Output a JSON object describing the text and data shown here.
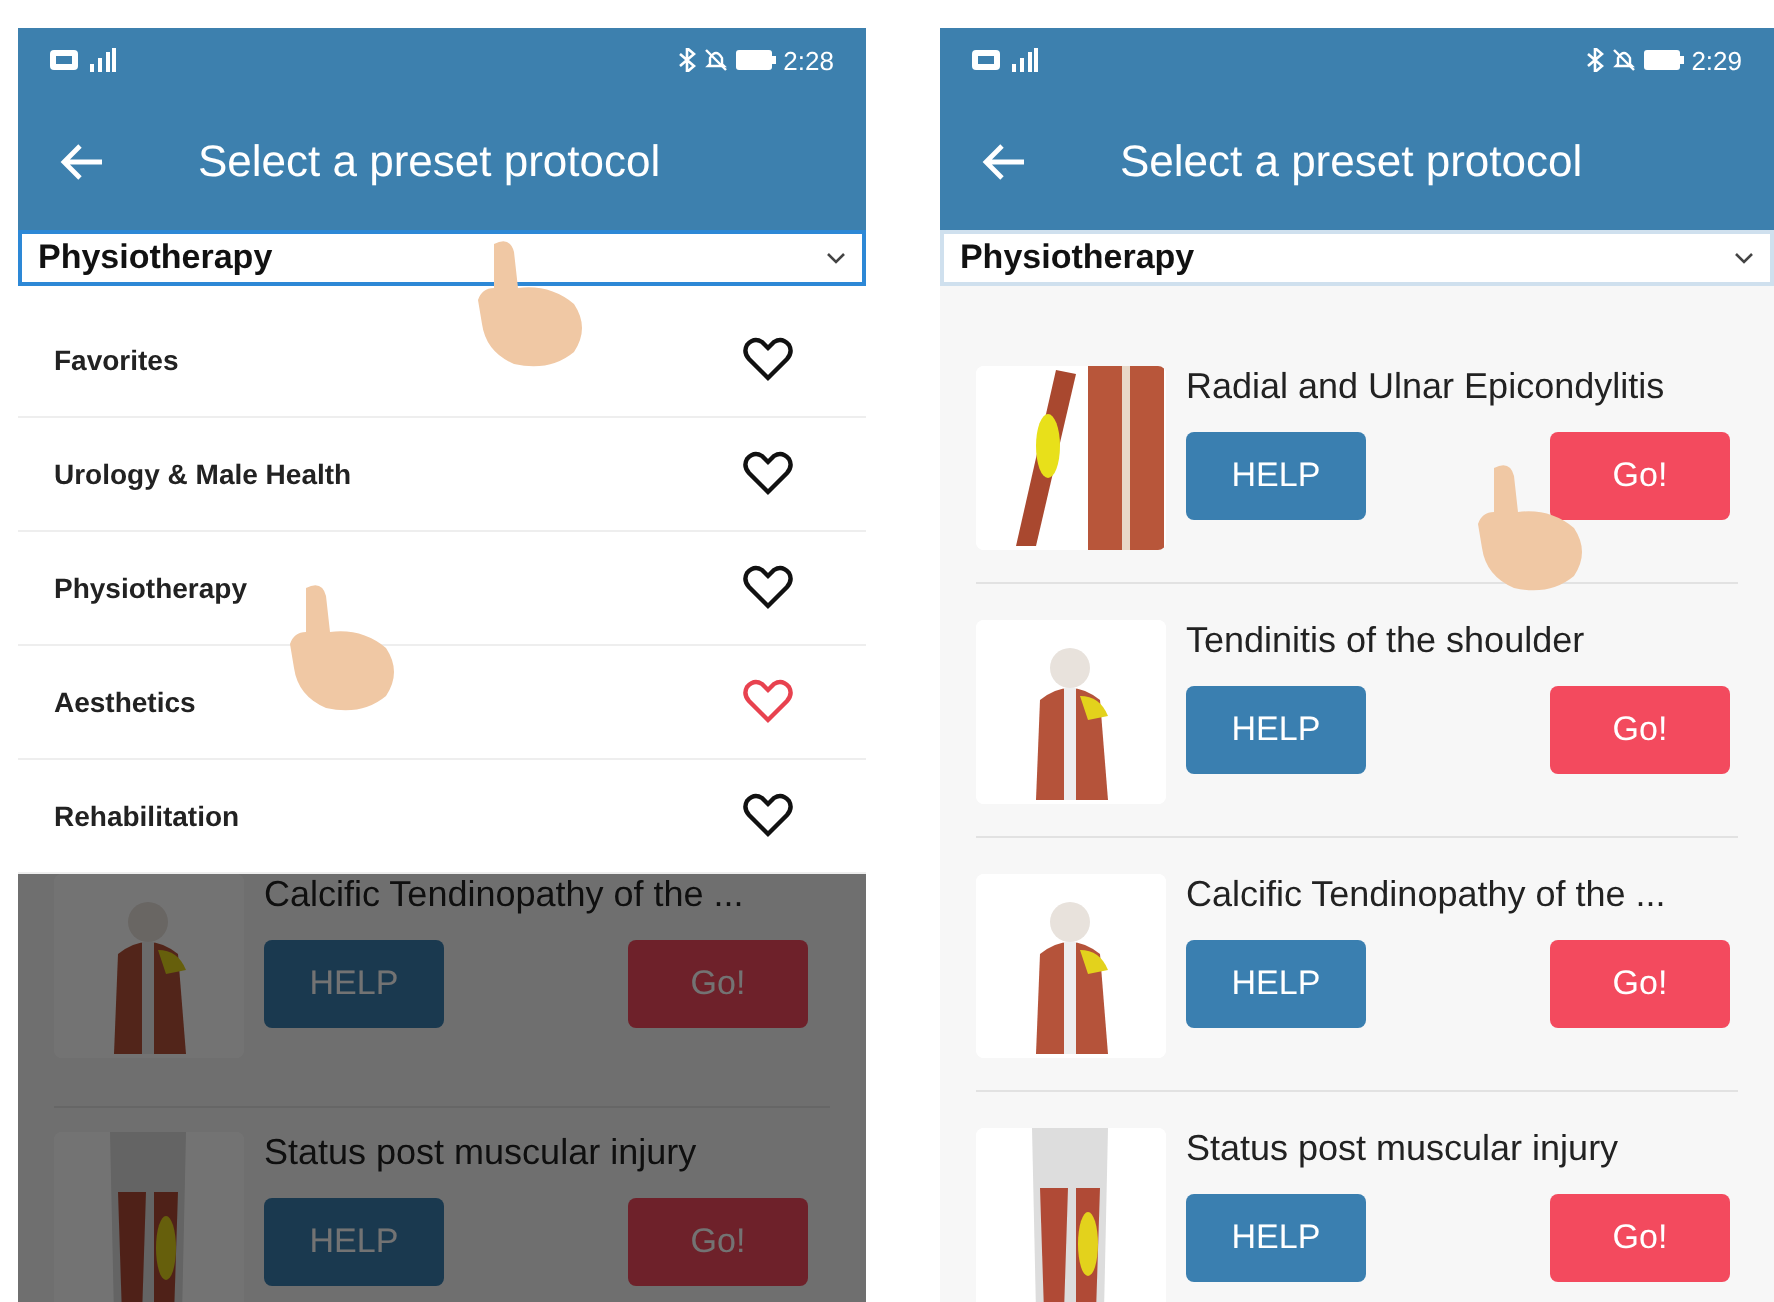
{
  "screens": [
    {
      "status_bar": {
        "time": "2:28"
      },
      "app_bar": {
        "title": "Select a preset protocol"
      },
      "category_select": {
        "value": "Physiotherapy",
        "open": true
      },
      "menu": {
        "items": [
          {
            "label": "Favorites",
            "favorite": false
          },
          {
            "label": "Urology & Male Health",
            "favorite": false
          },
          {
            "label": "Physiotherapy",
            "favorite": false
          },
          {
            "label": "Aesthetics",
            "favorite": true
          },
          {
            "label": "Rehabilitation",
            "favorite": false
          }
        ]
      },
      "protocols": [
        {
          "title": "Calcific Tendinopathy of the ...",
          "help": "HELP",
          "go": "Go!",
          "kind": "back"
        },
        {
          "title": "Status post muscular injury",
          "help": "HELP",
          "go": "Go!",
          "kind": "legs"
        }
      ]
    },
    {
      "status_bar": {
        "time": "2:29"
      },
      "app_bar": {
        "title": "Select a preset protocol"
      },
      "category_select": {
        "value": "Physiotherapy",
        "open": false
      },
      "protocols": [
        {
          "title": "Radial and Ulnar Epicondylitis",
          "help": "HELP",
          "go": "Go!",
          "kind": "arm"
        },
        {
          "title": "Tendinitis of the shoulder",
          "help": "HELP",
          "go": "Go!",
          "kind": "back"
        },
        {
          "title": "Calcific Tendinopathy of the ...",
          "help": "HELP",
          "go": "Go!",
          "kind": "back"
        },
        {
          "title": "Status post muscular injury",
          "help": "HELP",
          "go": "Go!",
          "kind": "legs"
        }
      ]
    }
  ]
}
